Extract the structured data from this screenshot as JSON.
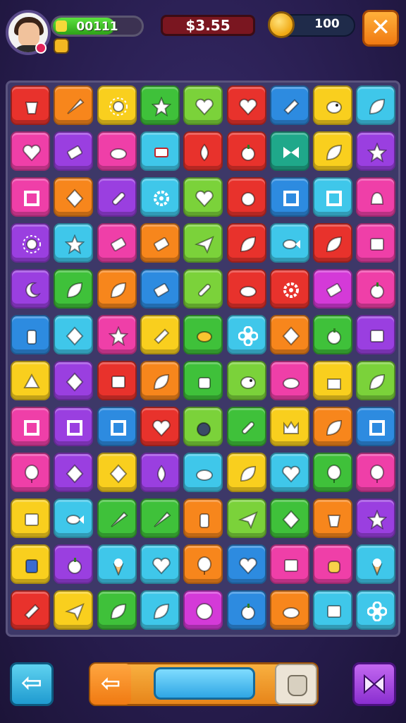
{
  "hud": {
    "score": "00111",
    "score_progress": 0.7,
    "timer": "$3.55",
    "coins": "100"
  },
  "colors": {
    "red": "#e8322c",
    "orange": "#f7861c",
    "yellow": "#f9cf1e",
    "green": "#3fc13a",
    "lime": "#7bd23a",
    "cyan": "#3fc7ea",
    "blue": "#2d8be0",
    "purple": "#9a3fe0",
    "pink": "#ef3fa8",
    "magenta": "#d43ad8",
    "teal": "#1fa88a"
  },
  "board": {
    "rows": [
      [
        "red:cup-icon",
        "orange:carrot-icon",
        "yellow:sun-icon",
        "green:star-icon",
        "lime:heart-icon",
        "red:heart-icon",
        "blue:pencil-icon",
        "yellow:bird-icon",
        "cyan:leaf-icon"
      ],
      [
        "pink:heart-icon",
        "purple:tag-icon",
        "pink:cloud-icon",
        "cyan:candy-icon",
        "red:drop-icon",
        "red:apple-icon",
        "teal:bowtie-icon",
        "yellow:leaf-icon",
        "purple:star-icon"
      ],
      [
        "pink:square-icon",
        "orange:diamond-icon",
        "purple:pen-icon",
        "cyan:gear-icon",
        "lime:heart-icon",
        "red:berry-icon",
        "blue:square-icon",
        "cyan:square-icon",
        "pink:bell-icon"
      ],
      [
        "purple:sun-icon",
        "cyan:star-icon",
        "pink:tag-icon",
        "orange:tag-icon",
        "lime:plane-icon",
        "red:leaf-icon",
        "cyan:fish-icon",
        "red:leaf-icon",
        "pink:box-icon"
      ],
      [
        "purple:moon-icon",
        "green:leaf-icon",
        "orange:leaf-icon",
        "blue:tag-icon",
        "lime:brush-icon",
        "red:cloud-icon",
        "red:gear-icon",
        "magenta:tag-icon",
        "pink:apple-icon"
      ],
      [
        "blue:bottle-icon",
        "cyan:diamond-icon",
        "pink:star-icon",
        "yellow:pencil-icon",
        "green:turtle-icon",
        "cyan:flower-icon",
        "orange:diamond-icon",
        "green:apple-icon",
        "purple:box-icon"
      ],
      [
        "yellow:shell-icon",
        "purple:diamond-icon",
        "red:box-icon",
        "orange:leaf-icon",
        "green:bag-icon",
        "lime:bird-icon",
        "pink:cloud-icon",
        "yellow:cake-icon",
        "lime:leaf-icon"
      ],
      [
        "pink:square-icon",
        "purple:square-icon",
        "blue:square-icon",
        "red:heart-icon",
        "lime:bomb-icon",
        "green:brush-icon",
        "yellow:crown-icon",
        "orange:leaf-icon",
        "blue:square-icon"
      ],
      [
        "pink:balloon-icon",
        "purple:diamond-icon",
        "yellow:diamond-icon",
        "purple:drop-icon",
        "cyan:cloud-icon",
        "yellow:leaf-icon",
        "cyan:heart-icon",
        "green:balloon-icon",
        "pink:balloon-icon"
      ],
      [
        "yellow:box-icon",
        "cyan:fish-icon",
        "green:carrot-icon",
        "green:carrot-icon",
        "orange:bottle-icon",
        "lime:plane-icon",
        "green:diamond-icon",
        "orange:cup-icon",
        "purple:star-icon"
      ],
      [
        "yellow:robot-icon",
        "purple:apple-icon",
        "cyan:icecream-icon",
        "cyan:heart-icon",
        "orange:balloon-icon",
        "blue:heart-icon",
        "pink:box-icon",
        "pink:cat-icon",
        "cyan:icecream-icon"
      ],
      [
        "red:pencil-icon",
        "yellow:plane-icon",
        "green:leaf-icon",
        "cyan:leaf-icon",
        "magenta:ball-icon",
        "blue:apple-icon",
        "orange:cloud-icon",
        "cyan:box-icon",
        "cyan:flower-icon"
      ]
    ]
  },
  "controls": {
    "back_label": "⇦",
    "tray_left_label": "⇦"
  }
}
